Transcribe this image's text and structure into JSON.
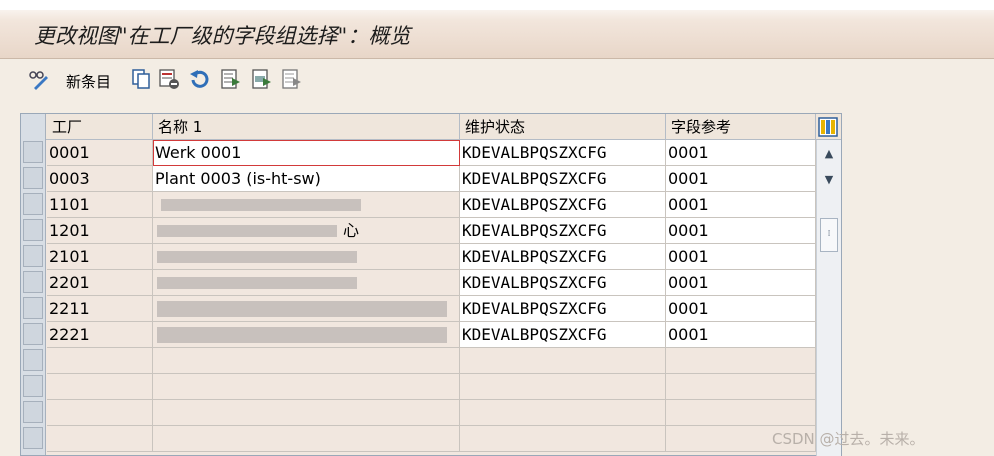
{
  "window": {
    "title": "更改视图\"在工厂级的字段组选择\"：概览"
  },
  "toolbar": {
    "new_entries_label": "新条目",
    "icons": [
      "display-change-icon",
      "copy-icon",
      "delete-icon",
      "undo-icon",
      "select-all-icon",
      "select-block-icon",
      "deselect-all-icon"
    ]
  },
  "table": {
    "headers": [
      "工厂",
      "名称 1",
      "维护状态",
      "字段参考"
    ],
    "rows": [
      {
        "plant": "0001",
        "name": "Werk 0001",
        "status": "KDEVALBPQSZXCFG",
        "ref": "0001"
      },
      {
        "plant": "0003",
        "name": "Plant 0003 (is-ht-sw)",
        "status": "KDEVALBPQSZXCFG",
        "ref": "0001"
      },
      {
        "plant": "1101",
        "name": "",
        "status": "KDEVALBPQSZXCFG",
        "ref": "0001"
      },
      {
        "plant": "1201",
        "name": "心",
        "status": "KDEVALBPQSZXCFG",
        "ref": "0001"
      },
      {
        "plant": "2101",
        "name": "",
        "status": "KDEVALBPQSZXCFG",
        "ref": "0001"
      },
      {
        "plant": "2201",
        "name": "",
        "status": "KDEVALBPQSZXCFG",
        "ref": "0001"
      },
      {
        "plant": "2211",
        "name": "",
        "status": "KDEVALBPQSZXCFG",
        "ref": "0001"
      },
      {
        "plant": "2221",
        "name": "",
        "status": "KDEVALBPQSZXCFG",
        "ref": "0001"
      }
    ]
  },
  "scrollbar": {
    "up_icon": "arrow-up-icon",
    "down_icon": "arrow-down-icon"
  },
  "watermark": "CSDN @过去。未来。",
  "colors": {
    "title_bg": "#e8d6c8",
    "table_bg": "#f1e7df",
    "row_bg": "#ffffff",
    "focus": "#d23a3a"
  }
}
